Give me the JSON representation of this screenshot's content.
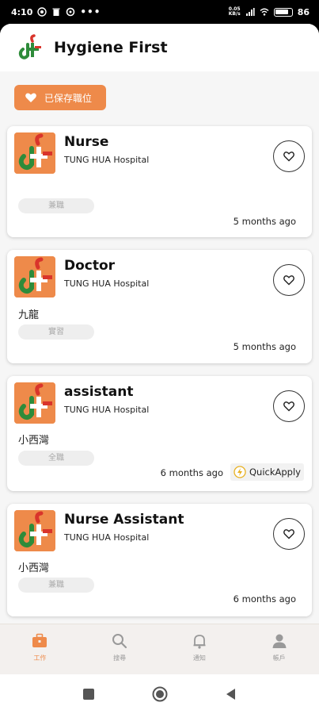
{
  "status": {
    "time": "4:10",
    "net_top": "0.05",
    "net_unit": "KB/s",
    "battery": "86"
  },
  "app": {
    "title": "Hygiene First"
  },
  "saved_button": {
    "label": "已保存職位"
  },
  "jobs": [
    {
      "title": "Nurse",
      "company": "TUNG HUA Hospital",
      "district": "",
      "tag": "兼職",
      "time": "5 months ago",
      "quick_apply": ""
    },
    {
      "title": "Doctor",
      "company": "TUNG HUA Hospital",
      "district": "九龍",
      "tag": "實習",
      "time": "5 months ago",
      "quick_apply": ""
    },
    {
      "title": "assistant",
      "company": "TUNG HUA Hospital",
      "district": "小西灣",
      "tag": "全職",
      "time": "6 months ago",
      "quick_apply": "QuickApply"
    },
    {
      "title": "Nurse Assistant",
      "company": "TUNG HUA Hospital",
      "district": "小西灣",
      "tag": "兼職",
      "time": "6 months ago",
      "quick_apply": ""
    }
  ],
  "nav": [
    {
      "label": "工作",
      "icon": "briefcase-icon",
      "active": true
    },
    {
      "label": "搜尋",
      "icon": "search-icon",
      "active": false
    },
    {
      "label": "通知",
      "icon": "bell-icon",
      "active": false
    },
    {
      "label": "帳戶",
      "icon": "user-icon",
      "active": false
    }
  ],
  "colors": {
    "accent": "#ee8a4a",
    "logo_green": "#2e8b3a",
    "logo_red": "#d9342b"
  }
}
